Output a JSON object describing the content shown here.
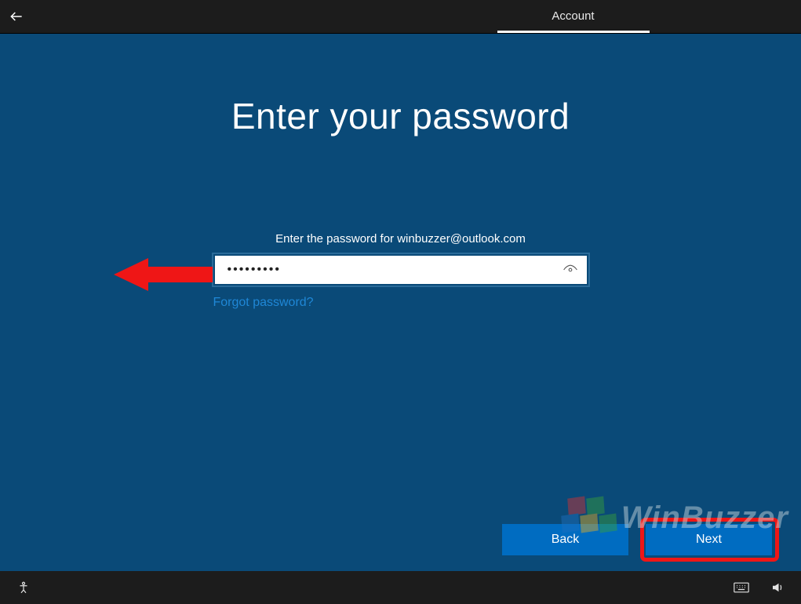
{
  "header": {
    "tab_label": "Account"
  },
  "main": {
    "title": "Enter your password",
    "instruction": "Enter the password for winbuzzer@outlook.com",
    "password_value": "•••••••••",
    "forgot_label": "Forgot password?"
  },
  "buttons": {
    "back": "Back",
    "next": "Next"
  },
  "watermark": {
    "text": "WinBuzzer"
  },
  "colors": {
    "accent": "#006cc1",
    "background": "#0a4a78",
    "link": "#1f87d6",
    "annotation": "#ef1616"
  }
}
